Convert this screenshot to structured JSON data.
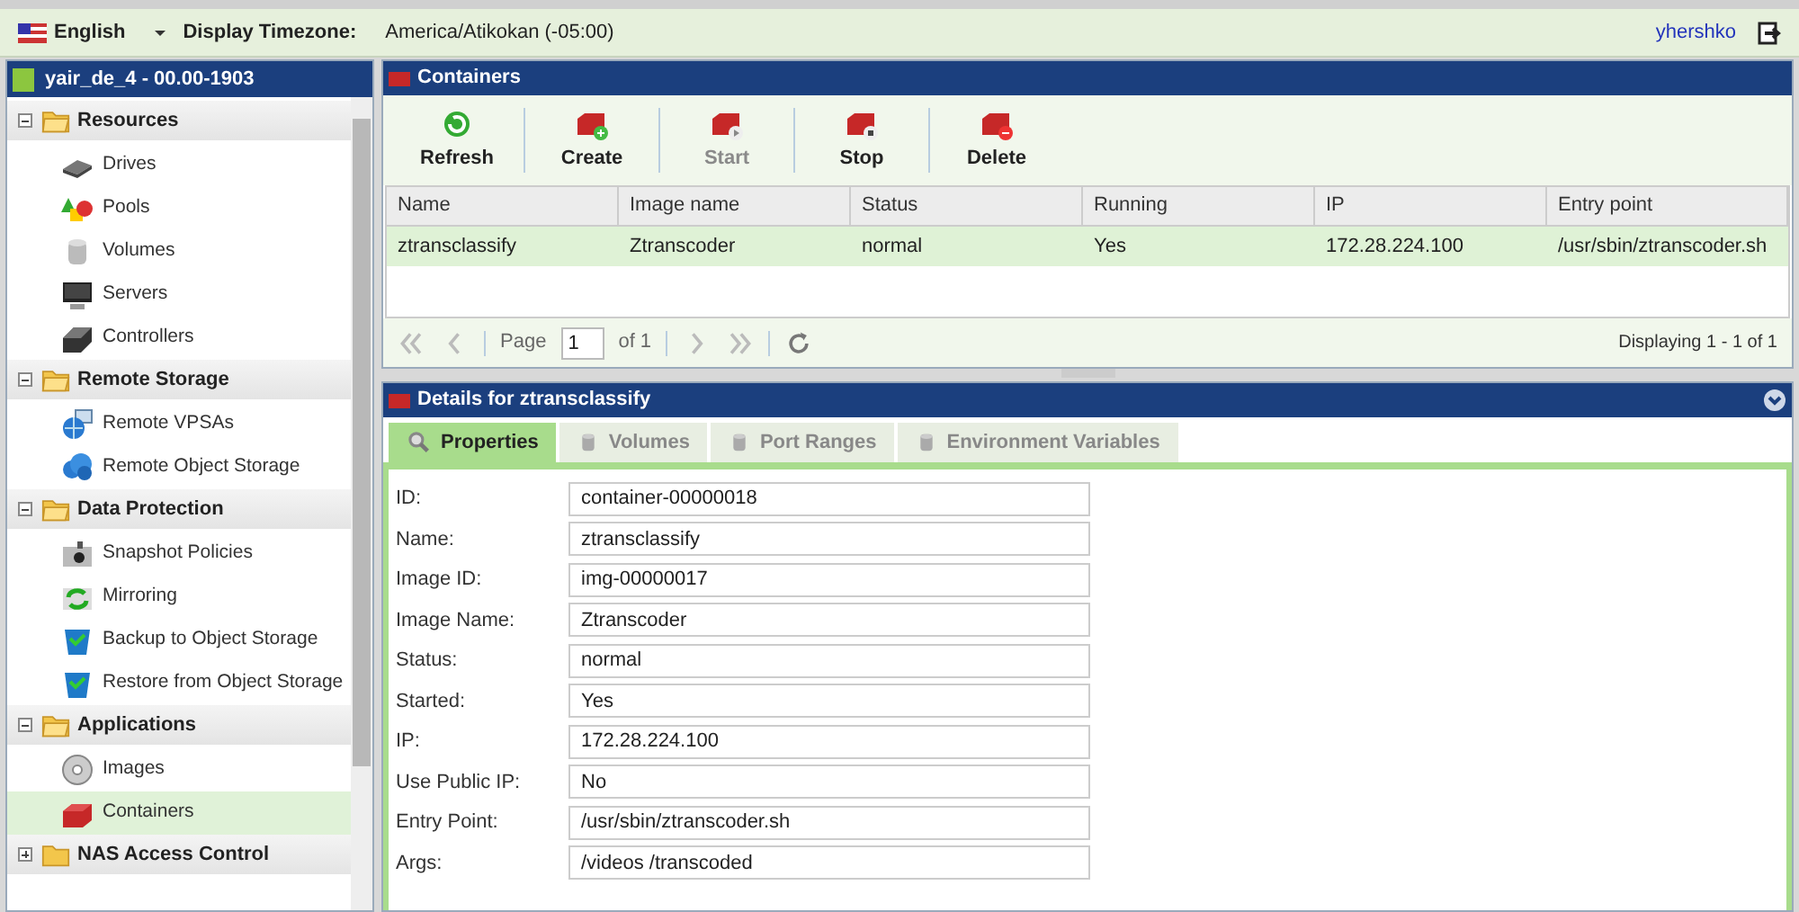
{
  "top_bar": {
    "language": "English",
    "timezone_label": "Display Timezone:",
    "timezone": "America/Atikokan (-05:00)",
    "user": "yhershko"
  },
  "sidebar": {
    "title": "yair_de_4 - 00.00-1903",
    "groups": [
      {
        "label": "Resources",
        "expanded": true,
        "children": [
          {
            "label": "Drives",
            "selected": false
          },
          {
            "label": "Pools",
            "selected": false
          },
          {
            "label": "Volumes",
            "selected": false
          },
          {
            "label": "Servers",
            "selected": false
          },
          {
            "label": "Controllers",
            "selected": false
          }
        ]
      },
      {
        "label": "Remote Storage",
        "expanded": true,
        "children": [
          {
            "label": "Remote VPSAs",
            "selected": false
          },
          {
            "label": "Remote Object Storage",
            "selected": false
          }
        ]
      },
      {
        "label": "Data Protection",
        "expanded": true,
        "children": [
          {
            "label": "Snapshot Policies",
            "selected": false
          },
          {
            "label": "Mirroring",
            "selected": false
          },
          {
            "label": "Backup to Object Storage",
            "selected": false
          },
          {
            "label": "Restore from Object Storage",
            "selected": false
          }
        ]
      },
      {
        "label": "Applications",
        "expanded": true,
        "children": [
          {
            "label": "Images",
            "selected": false
          },
          {
            "label": "Containers",
            "selected": true
          }
        ]
      },
      {
        "label": "NAS Access Control",
        "expanded": false
      }
    ]
  },
  "containers": {
    "title": "Containers",
    "toolbar": [
      {
        "label": "Refresh",
        "disabled": false
      },
      {
        "label": "Create",
        "disabled": false
      },
      {
        "label": "Start",
        "disabled": true
      },
      {
        "label": "Stop",
        "disabled": false
      },
      {
        "label": "Delete",
        "disabled": false
      }
    ],
    "table": {
      "columns": [
        "Name",
        "Image name",
        "Status",
        "Running",
        "IP",
        "Entry point"
      ],
      "rows": [
        {
          "cells": [
            "ztransclassify",
            "Ztranscoder",
            "normal",
            "Yes",
            "172.28.224.100",
            "/usr/sbin/ztranscoder.sh"
          ],
          "selected": true
        }
      ]
    },
    "pager": {
      "page_label": "Page",
      "page": "1",
      "of": "of 1",
      "displaying": "Displaying 1 - 1 of 1"
    }
  },
  "details": {
    "title": "Details for ztransclassify",
    "tabs": [
      {
        "label": "Properties",
        "selected": true
      },
      {
        "label": "Volumes",
        "selected": false
      },
      {
        "label": "Port Ranges",
        "selected": false
      },
      {
        "label": "Environment Variables",
        "selected": false
      }
    ],
    "fields": [
      {
        "label": "ID:",
        "value": "container-00000018"
      },
      {
        "label": "Name:",
        "value": "ztransclassify"
      },
      {
        "label": "Image ID:",
        "value": "img-00000017"
      },
      {
        "label": "Image Name:",
        "value": "Ztranscoder"
      },
      {
        "label": "Status:",
        "value": "normal"
      },
      {
        "label": "Started:",
        "value": "Yes"
      },
      {
        "label": "IP:",
        "value": "172.28.224.100"
      },
      {
        "label": "Use Public IP:",
        "value": "No"
      },
      {
        "label": "Entry Point:",
        "value": "/usr/sbin/ztranscoder.sh"
      },
      {
        "label": "Args:",
        "value": "/videos /transcoded"
      }
    ]
  }
}
